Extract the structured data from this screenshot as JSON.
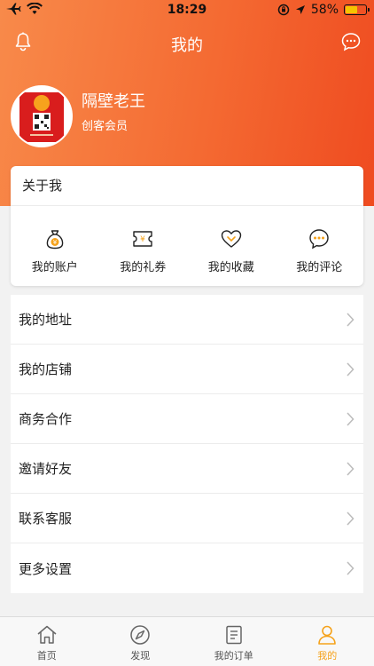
{
  "status_bar": {
    "time": "18:29",
    "battery": "58%",
    "battery_level": 0.58
  },
  "nav": {
    "title": "我的"
  },
  "profile": {
    "name": "隔壁老王",
    "level": "创客会员"
  },
  "about": {
    "title": "关于我",
    "quick_items": [
      {
        "label": "我的账户",
        "icon": "money-bag-icon"
      },
      {
        "label": "我的礼券",
        "icon": "coupon-icon"
      },
      {
        "label": "我的收藏",
        "icon": "heart-icon"
      },
      {
        "label": "我的评论",
        "icon": "comment-icon"
      }
    ]
  },
  "menu": [
    {
      "label": "我的地址"
    },
    {
      "label": "我的店铺"
    },
    {
      "label": "商务合作"
    },
    {
      "label": "邀请好友"
    },
    {
      "label": "联系客服"
    },
    {
      "label": "更多设置"
    }
  ],
  "tabs": [
    {
      "label": "首页",
      "icon": "home-icon"
    },
    {
      "label": "发现",
      "icon": "compass-icon"
    },
    {
      "label": "我的订单",
      "icon": "order-icon"
    },
    {
      "label": "我的",
      "icon": "user-icon"
    }
  ],
  "colors": {
    "accent": "#f46a32",
    "active_tab": "#f5a21b"
  }
}
